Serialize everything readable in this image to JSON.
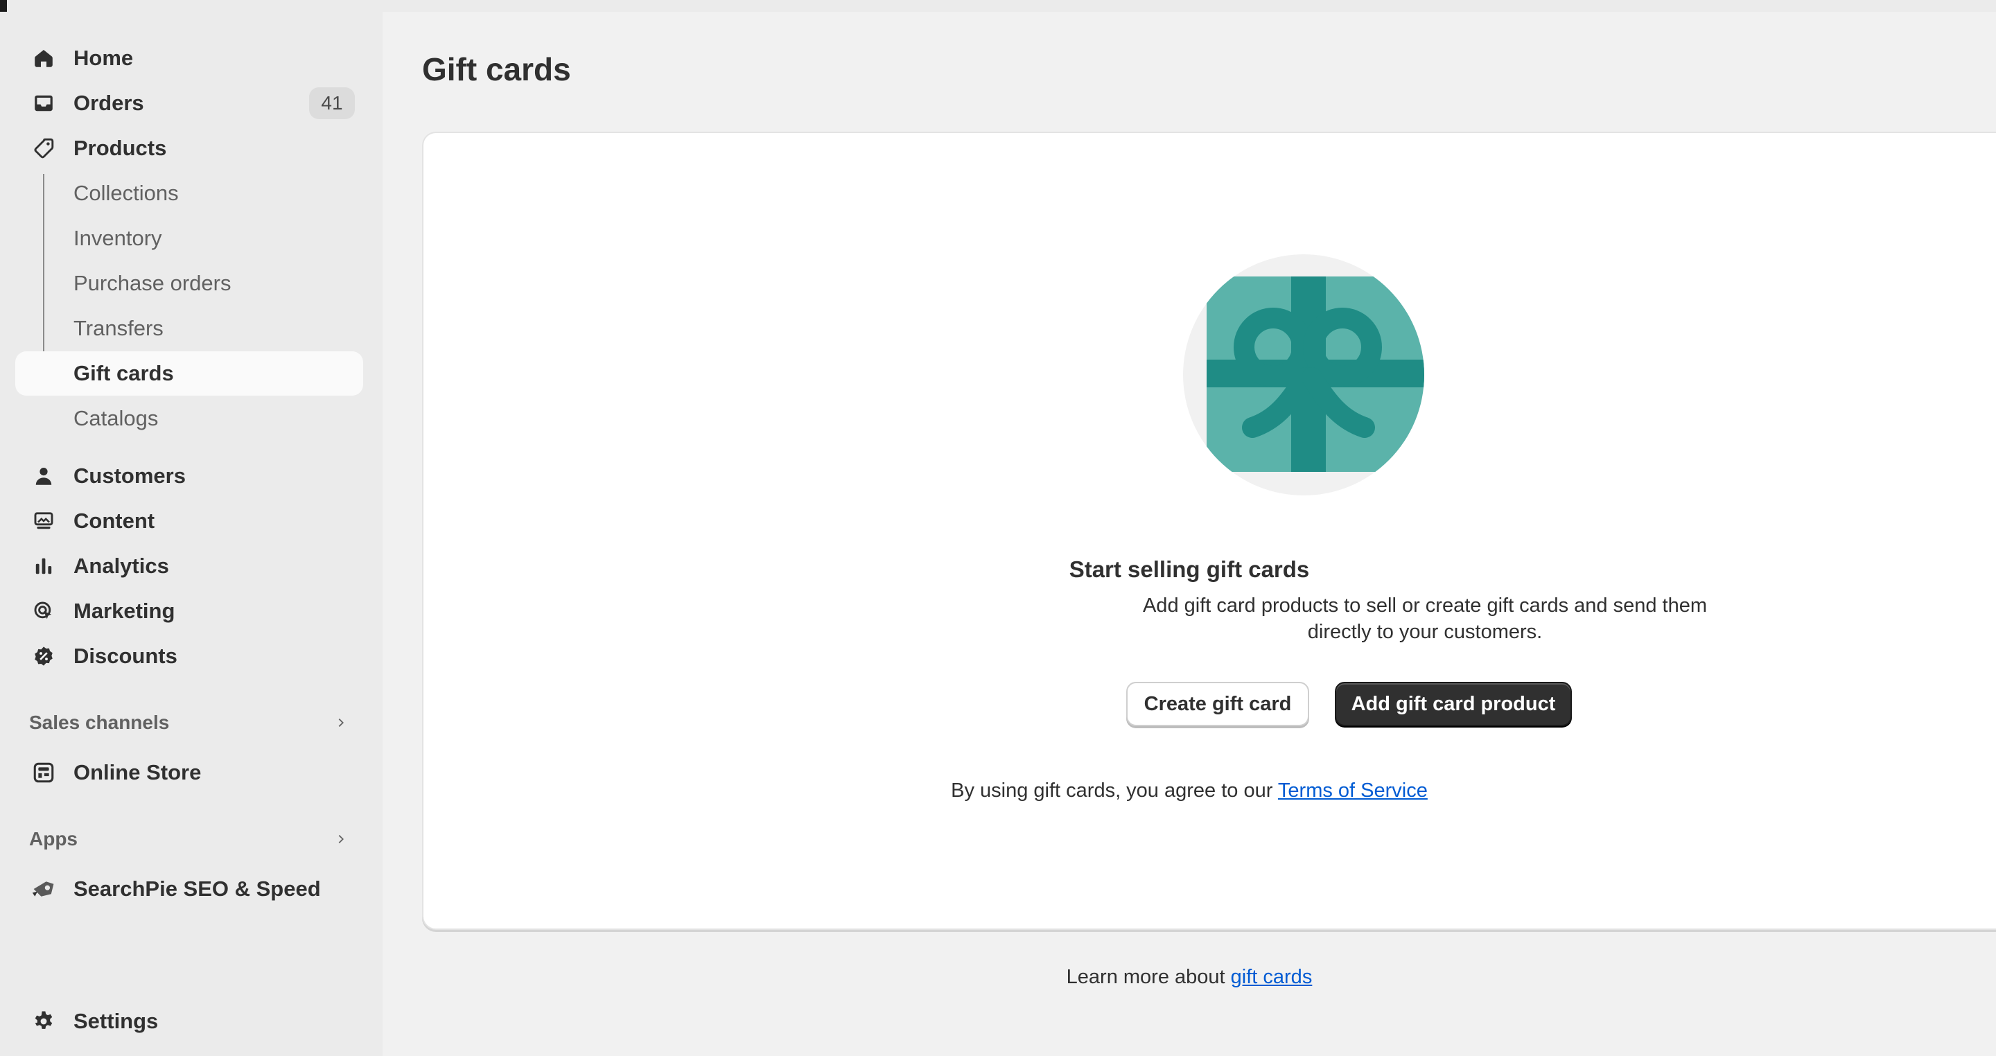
{
  "nav": {
    "home": "Home",
    "orders": "Orders",
    "orders_count": "41",
    "products": "Products",
    "collections": "Collections",
    "inventory": "Inventory",
    "purchase_orders": "Purchase orders",
    "transfers": "Transfers",
    "gift_cards": "Gift cards",
    "catalogs": "Catalogs",
    "customers": "Customers",
    "content": "Content",
    "analytics": "Analytics",
    "marketing": "Marketing",
    "discounts": "Discounts",
    "sales_channels": "Sales channels",
    "online_store": "Online Store",
    "apps": "Apps",
    "searchpie": "SearchPie SEO & Speed",
    "settings": "Settings"
  },
  "page": {
    "title": "Gift cards",
    "empty_title": "Start selling gift cards",
    "empty_desc": "Add gift card products to sell or create gift cards and send them directly to your customers.",
    "create_button": "Create gift card",
    "add_button": "Add gift card product",
    "terms_prefix": "By using gift cards, you agree to our ",
    "terms_link": "Terms of Service",
    "learn_prefix": "Learn more about ",
    "learn_link": "gift cards"
  },
  "colors": {
    "accent_primary_button": "#303030",
    "link": "#005bd3",
    "giftcard_light": "#5bb3aa",
    "giftcard_dark": "#1f8c85"
  }
}
